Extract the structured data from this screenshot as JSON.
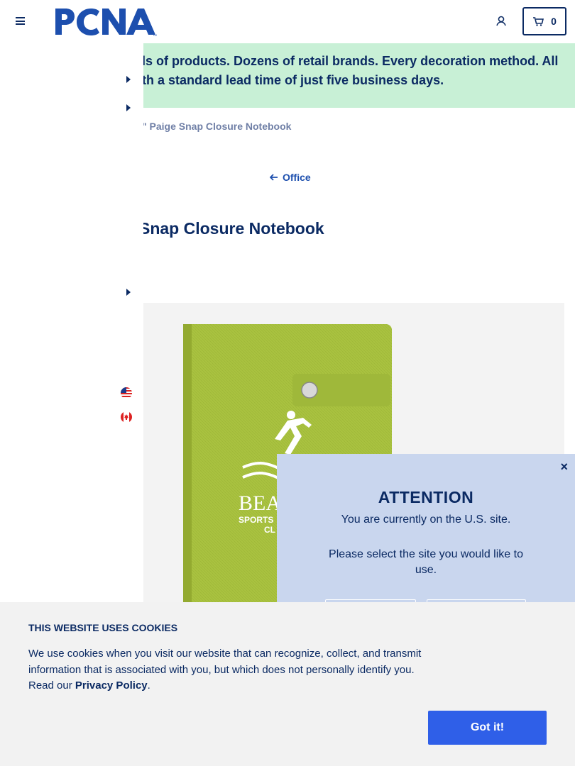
{
  "header": {
    "cart_count": "0"
  },
  "banner": {
    "text": "ls of products. Dozens of retail brands. Every decoration method. All th a standard lead time of just five business days."
  },
  "breadcrumb": {
    "current": "\" Paige Snap Closure Notebook"
  },
  "back_link": {
    "label": "Office"
  },
  "product": {
    "title": "Snap Closure Notebook",
    "imprint_line1": "BEA",
    "imprint_line2": "SPORTS",
    "imprint_line3": "CL"
  },
  "modal": {
    "title": "ATTENTION",
    "line1": "You are currently on the U.S. site.",
    "line2": "Please select the site you would like to use.",
    "close_glyph": "×"
  },
  "cookie": {
    "title": "THIS WEBSITE USES COOKIES",
    "text": "We use cookies when you visit our website that can recognize, collect, and transmit information that is associated with you, but which does not personally identify you. Read our",
    "link": "Privacy Policy",
    "after": ".",
    "button": "Got it!"
  },
  "colors": {
    "navy": "#0b2a63",
    "banner_bg": "#c8f0d6",
    "accent_blue": "#2f5fe8",
    "modal_bg": "#c9d6ee"
  }
}
